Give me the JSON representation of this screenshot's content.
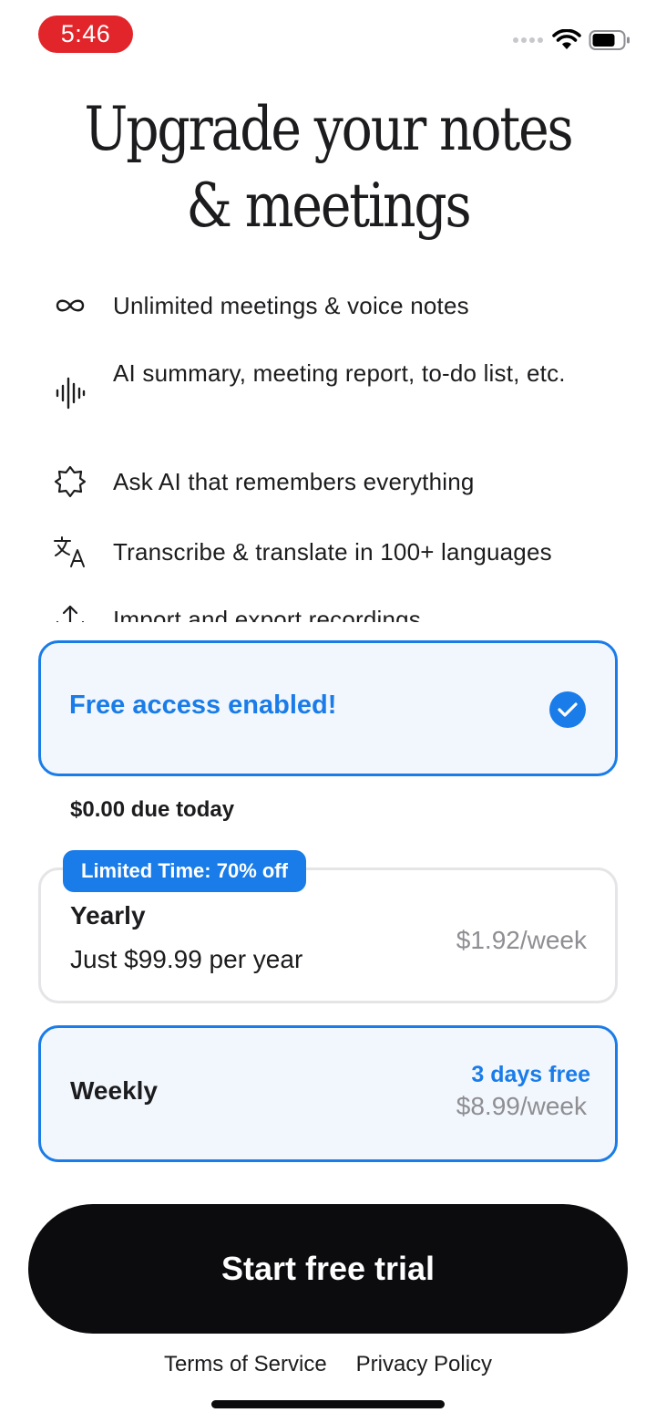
{
  "status_bar": {
    "time": "5:46"
  },
  "title": {
    "line1": "Upgrade your notes",
    "line2": "& meetings"
  },
  "features": [
    {
      "icon": "infinity-icon",
      "text": "Unlimited meetings & voice notes"
    },
    {
      "icon": "waveform-icon",
      "text": "AI summary, meeting report, to-do list, etc."
    },
    {
      "icon": "sparkle-badge-icon",
      "text": "Ask AI that remembers everything"
    },
    {
      "icon": "translate-icon",
      "text": "Transcribe & translate in 100+ languages"
    },
    {
      "icon": "import-export-icon",
      "text": "Import and export recordings"
    }
  ],
  "free_access": {
    "label": "Free access enabled!",
    "checked": true
  },
  "due_today": "$0.00 due today",
  "plans": {
    "yearly": {
      "badge": "Limited Time: 70% off",
      "name": "Yearly",
      "subtitle": "Just $99.99 per year",
      "price": "$1.92/week"
    },
    "weekly": {
      "name": "Weekly",
      "trial": "3 days free",
      "price": "$8.99/week",
      "selected": true
    }
  },
  "cta": {
    "label": "Start free trial"
  },
  "footer": {
    "terms": "Terms of Service",
    "privacy": "Privacy Policy"
  },
  "colors": {
    "accent": "#1a7ce8",
    "cta_bg": "#0c0c0e",
    "status_time_bg": "#e2252b"
  }
}
